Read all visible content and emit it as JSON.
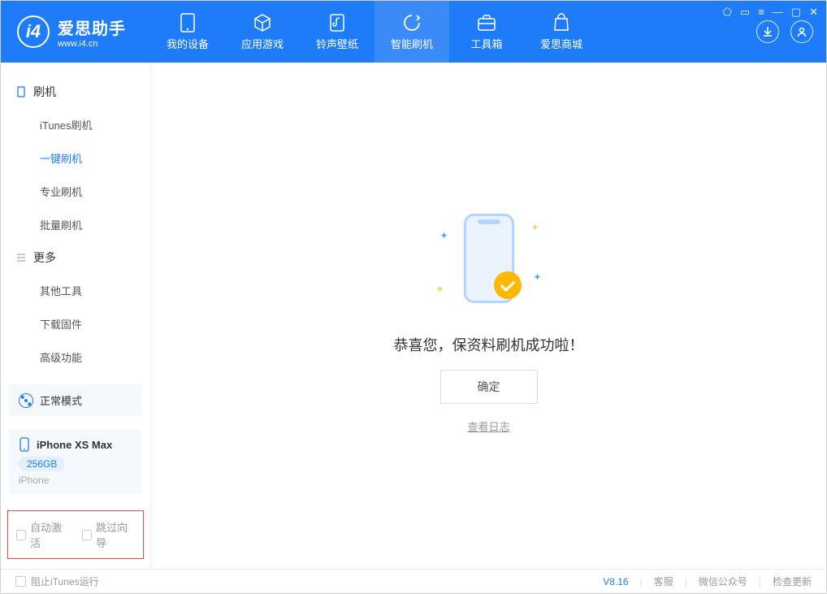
{
  "logo": {
    "title": "爱思助手",
    "subtitle": "www.i4.cn"
  },
  "tabs": [
    {
      "label": "我的设备"
    },
    {
      "label": "应用游戏"
    },
    {
      "label": "铃声壁纸"
    },
    {
      "label": "智能刷机"
    },
    {
      "label": "工具箱"
    },
    {
      "label": "爱思商城"
    }
  ],
  "sidebar": {
    "cat1": "刷机",
    "items1": [
      {
        "label": "iTunes刷机"
      },
      {
        "label": "一键刷机"
      },
      {
        "label": "专业刷机"
      },
      {
        "label": "批量刷机"
      }
    ],
    "cat2": "更多",
    "items2": [
      {
        "label": "其他工具"
      },
      {
        "label": "下载固件"
      },
      {
        "label": "高级功能"
      }
    ]
  },
  "mode": {
    "label": "正常模式"
  },
  "device": {
    "name": "iPhone XS Max",
    "storage": "256GB",
    "type": "iPhone"
  },
  "checks": {
    "c1": "自动激活",
    "c2": "跳过向导"
  },
  "main": {
    "success": "恭喜您，保资料刷机成功啦！",
    "ok": "确定",
    "log": "查看日志"
  },
  "footer": {
    "block": "阻止iTunes运行",
    "version": "V8.16",
    "links": [
      "客服",
      "微信公众号",
      "检查更新"
    ]
  }
}
